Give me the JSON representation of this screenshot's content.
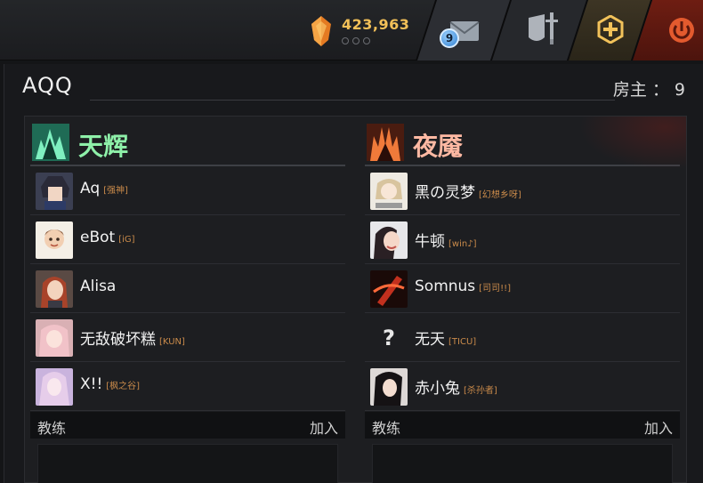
{
  "topbar": {
    "currency": {
      "value": "423,963",
      "icon": "shard-icon"
    },
    "mail": {
      "badge_count": "9",
      "icon": "mail-icon"
    },
    "armory_icon": "shield-sword-icon",
    "plus_icon": "plus-icon",
    "power_icon": "power-icon"
  },
  "lobby": {
    "name": "AQQ",
    "host_label": "房主",
    "host_sep": "：",
    "host_count": "9"
  },
  "teams": [
    {
      "name": "天辉",
      "color": "#8ef0a9",
      "players": [
        {
          "name": "Aq",
          "tag": "[强神]"
        },
        {
          "name": "eBot",
          "tag": "[iG]"
        },
        {
          "name": "Alisa",
          "tag": ""
        },
        {
          "name": "无敌破坏糕",
          "tag": "[KUN]"
        },
        {
          "name": "X!!",
          "tag": "[枫之谷]"
        }
      ],
      "coach_label": "教练",
      "join_label": "加入"
    },
    {
      "name": "夜魇",
      "color": "#ffb9a3",
      "players": [
        {
          "name": "黑の灵梦",
          "tag": "[幻想乡呀]"
        },
        {
          "name": "牛顿",
          "tag": "[win♪]"
        },
        {
          "name": "Somnus",
          "tag": "[司司!!]"
        },
        {
          "name": "无天",
          "tag": "[TICU]",
          "avatar_text": "?"
        },
        {
          "name": "赤小兔",
          "tag": "[杀孙者]"
        }
      ],
      "coach_label": "教练",
      "join_label": "加入"
    }
  ]
}
